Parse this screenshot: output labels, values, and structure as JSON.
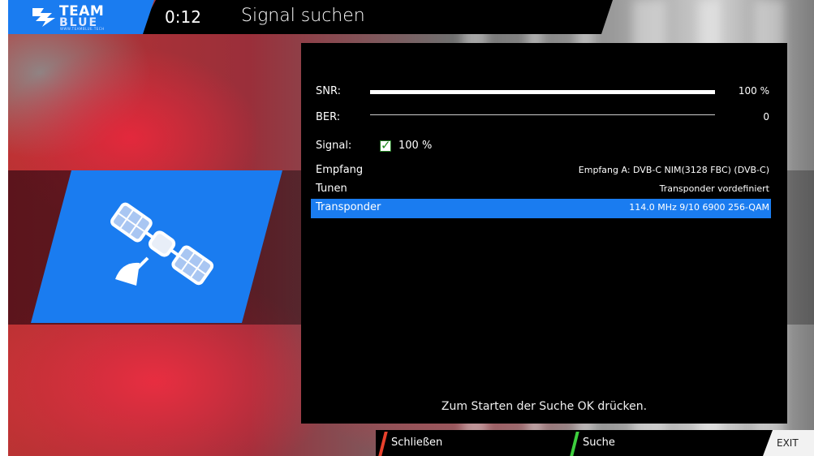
{
  "header": {
    "logo_line1": "TEAM",
    "logo_line2": "BLUE",
    "logo_small": "WWW.TEAMBLUE.TECH",
    "clock": "0:12",
    "title": "Signal suchen"
  },
  "signal": {
    "snr_label": "SNR:",
    "snr_value": "100 %",
    "snr_level": 1.0,
    "ber_label": "BER:",
    "ber_value": "0",
    "signal_label": "Signal:",
    "signal_value": "100 %"
  },
  "settings": [
    {
      "label": "Empfang",
      "value": "Empfang A: DVB-C NIM(3128 FBC) (DVB-C)"
    },
    {
      "label": "Tunen",
      "value": "Transponder vordefiniert"
    },
    {
      "label": "Transponder",
      "value": "114.0 MHz 9/10 6900 256-QAM"
    }
  ],
  "footer_message": "Zum Starten der Suche OK drücken.",
  "buttons": {
    "red_label": "Schließen",
    "green_label": "Suche",
    "exit_label": "EXIT"
  },
  "colors": {
    "accent": "#1a7cf0",
    "red_key": "#e8412c",
    "green_key": "#3ecf3e"
  },
  "icons": [
    "team-blue-logo-icon",
    "satellite-icon",
    "checkmark-icon"
  ]
}
